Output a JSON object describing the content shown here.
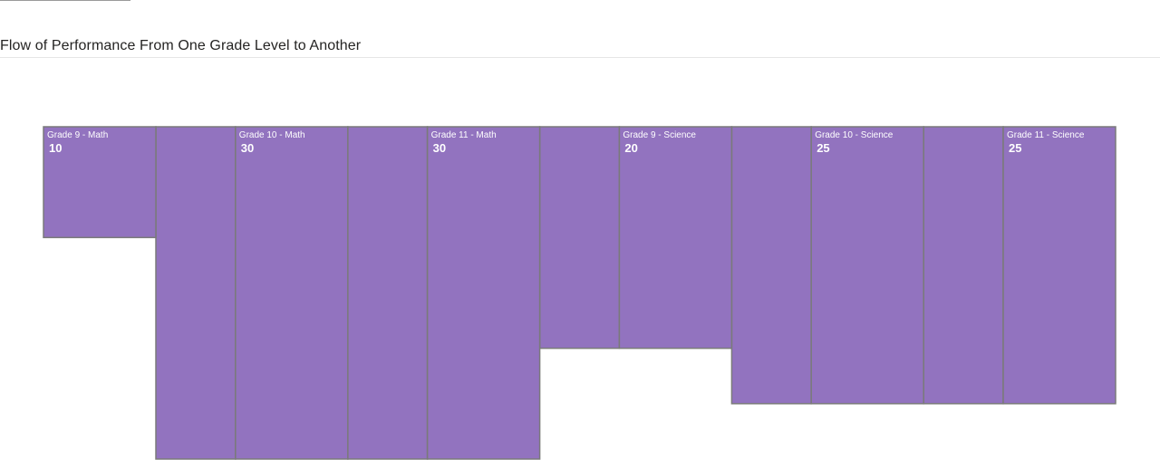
{
  "header": {
    "title": "Flow of Performance From One Grade Level to Another"
  },
  "colors": {
    "bar_fill": "#9273bf",
    "bar_stroke": "#7a7a7a",
    "label_text": "#ffffff"
  },
  "chart_data": {
    "type": "bar",
    "subtype": "ribbon",
    "title": "Flow of Performance From One Grade Level to Another",
    "xlabel": "",
    "ylabel": "",
    "categories": [
      "Grade 9 - Math",
      "Grade 10 - Math",
      "Grade 11 - Math",
      "Grade 9 - Science",
      "Grade 10 - Science",
      "Grade 11 - Science"
    ],
    "values": [
      10,
      30,
      30,
      20,
      25,
      25
    ],
    "value_labels": [
      "10",
      "30",
      "30",
      "20",
      "25",
      "25"
    ],
    "ribbons": true,
    "legend": "none",
    "grid": false
  }
}
